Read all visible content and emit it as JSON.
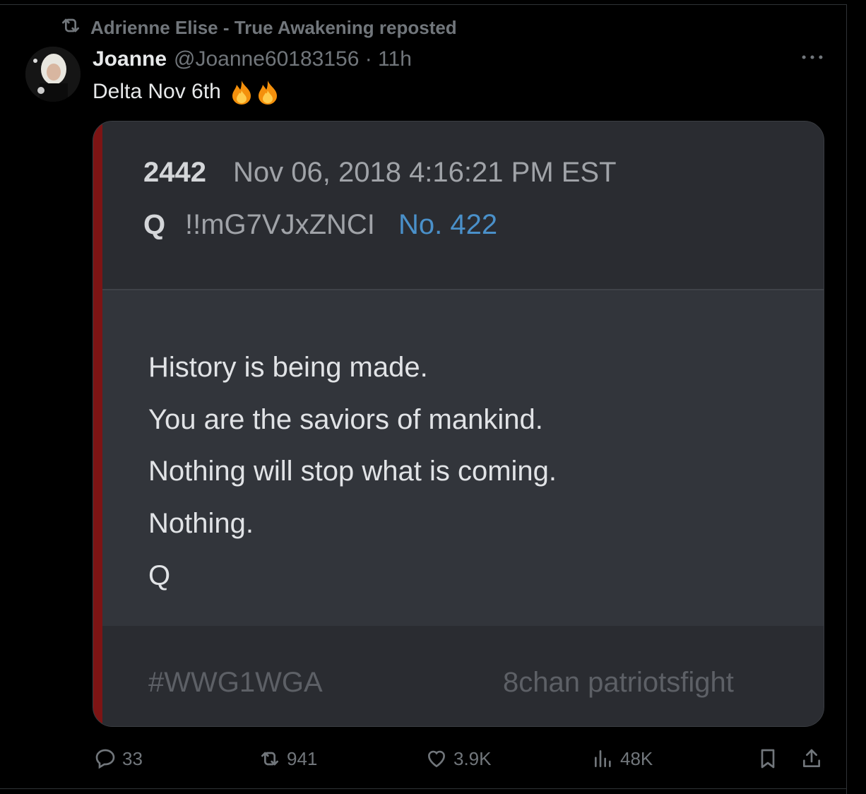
{
  "repost": {
    "text": "Adrienne Elise - True Awakening reposted"
  },
  "tweet": {
    "name": "Joanne",
    "handle": "@Joanne60183156 · 11h",
    "text": "Delta Nov 6th"
  },
  "media": {
    "post_id": "2442",
    "post_date": "Nov 06, 2018 4:16:21 PM EST",
    "author": "Q",
    "tripcode": "!!mG7VJxZNCI",
    "post_number": "No. 422",
    "lines": [
      "History is being made.",
      "You are the saviors of mankind.",
      "Nothing will stop what is coming.",
      "Nothing.",
      "Q"
    ],
    "hashtag": "#WWG1WGA",
    "source": "8chan patriotsfight"
  },
  "actions": {
    "replies": "33",
    "reposts": "941",
    "likes": "3.9K",
    "views": "48K"
  },
  "colors": {
    "background": "#000000",
    "muted": "#71767b",
    "link": "#4a90c9",
    "accent_bar": "#7d1414"
  }
}
